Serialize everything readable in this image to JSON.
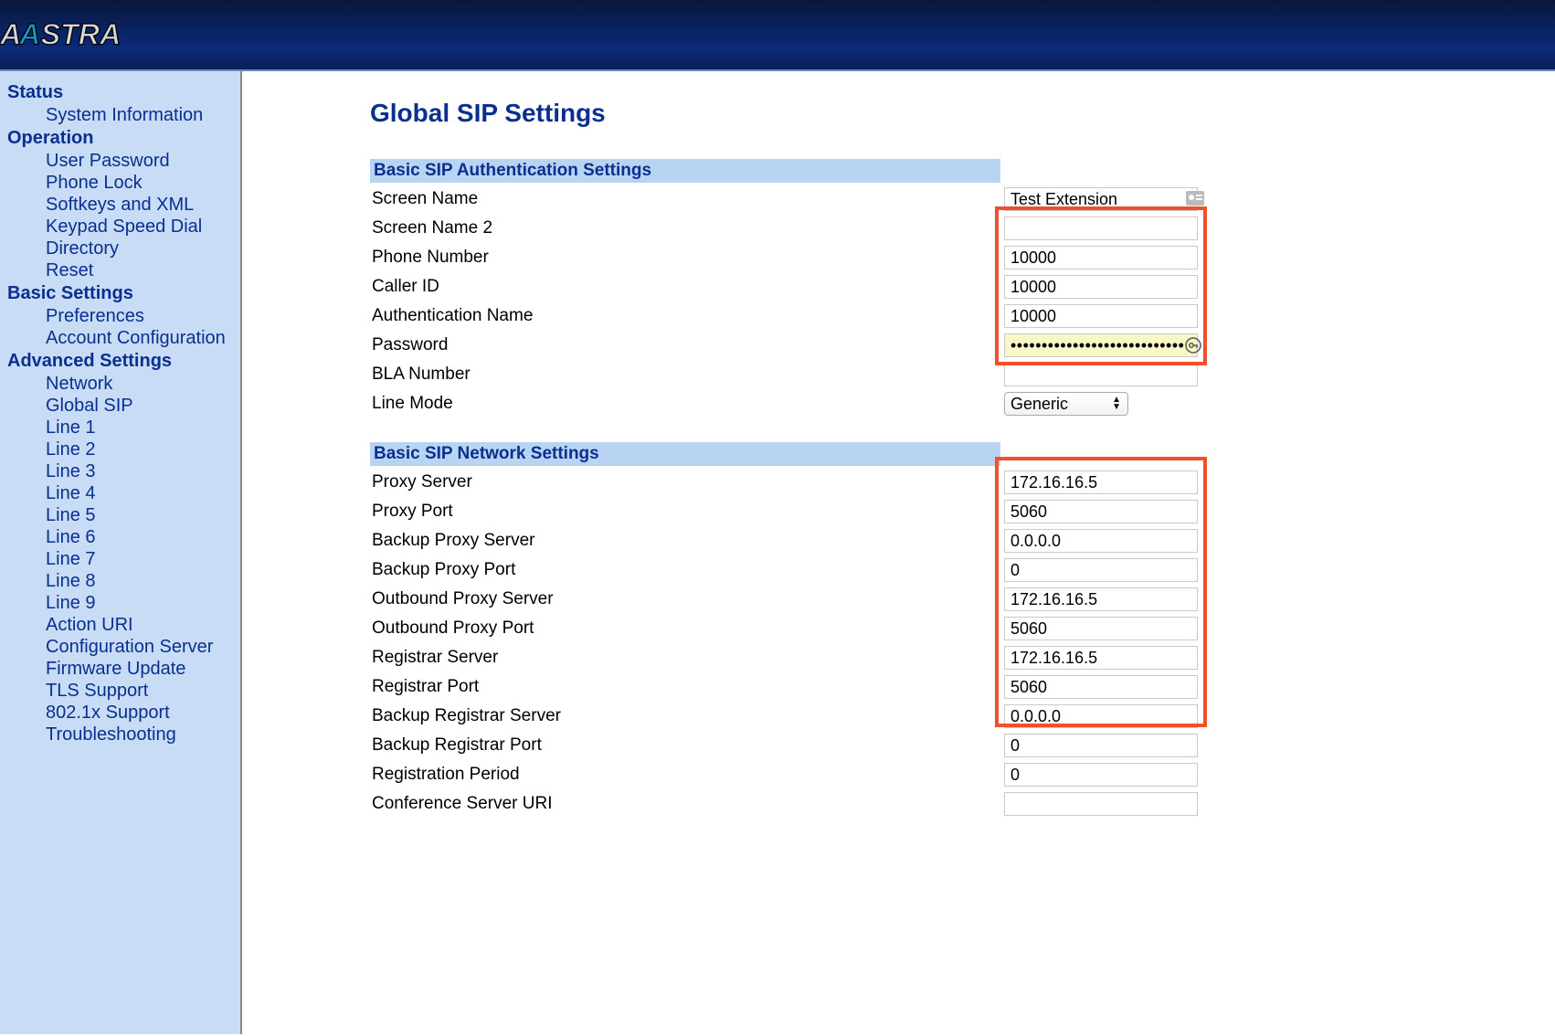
{
  "brand": "AASTRA",
  "sidebar": {
    "groups": [
      {
        "title": "Status",
        "items": [
          "System Information"
        ]
      },
      {
        "title": "Operation",
        "items": [
          "User Password",
          "Phone Lock",
          "Softkeys and XML",
          "Keypad Speed Dial",
          "Directory",
          "Reset"
        ]
      },
      {
        "title": "Basic Settings",
        "items": [
          "Preferences",
          "Account Configuration"
        ]
      },
      {
        "title": "Advanced Settings",
        "items": [
          "Network",
          "Global SIP",
          "Line 1",
          "Line 2",
          "Line 3",
          "Line 4",
          "Line 5",
          "Line 6",
          "Line 7",
          "Line 8",
          "Line 9",
          "Action URI",
          "Configuration Server",
          "Firmware Update",
          "TLS Support",
          "802.1x Support",
          "Troubleshooting"
        ]
      }
    ]
  },
  "page": {
    "title": "Global SIP Settings",
    "sections": {
      "auth": {
        "header": "Basic SIP Authentication Settings",
        "fields": {
          "screen_name": {
            "label": "Screen Name",
            "value": "Test Extension"
          },
          "screen_name_2": {
            "label": "Screen Name 2",
            "value": ""
          },
          "phone_number": {
            "label": "Phone Number",
            "value": "10000"
          },
          "caller_id": {
            "label": "Caller ID",
            "value": "10000"
          },
          "auth_name": {
            "label": "Authentication Name",
            "value": "10000"
          },
          "password": {
            "label": "Password",
            "value": "••••••••••••••••••••••••••••"
          },
          "bla_number": {
            "label": "BLA Number",
            "value": ""
          },
          "line_mode": {
            "label": "Line Mode",
            "value": "Generic"
          }
        }
      },
      "network": {
        "header": "Basic SIP Network Settings",
        "fields": {
          "proxy_server": {
            "label": "Proxy Server",
            "value": "172.16.16.5"
          },
          "proxy_port": {
            "label": "Proxy Port",
            "value": "5060"
          },
          "backup_proxy_server": {
            "label": "Backup Proxy Server",
            "value": "0.0.0.0"
          },
          "backup_proxy_port": {
            "label": "Backup Proxy Port",
            "value": "0"
          },
          "outbound_proxy_server": {
            "label": "Outbound Proxy Server",
            "value": "172.16.16.5"
          },
          "outbound_proxy_port": {
            "label": "Outbound Proxy Port",
            "value": "5060"
          },
          "registrar_server": {
            "label": "Registrar Server",
            "value": "172.16.16.5"
          },
          "registrar_port": {
            "label": "Registrar Port",
            "value": "5060"
          },
          "backup_registrar_server": {
            "label": "Backup Registrar Server",
            "value": "0.0.0.0"
          },
          "backup_registrar_port": {
            "label": "Backup Registrar Port",
            "value": "0"
          },
          "registration_period": {
            "label": "Registration Period",
            "value": "0"
          },
          "conference_server_uri": {
            "label": "Conference Server URI",
            "value": ""
          }
        }
      }
    }
  }
}
